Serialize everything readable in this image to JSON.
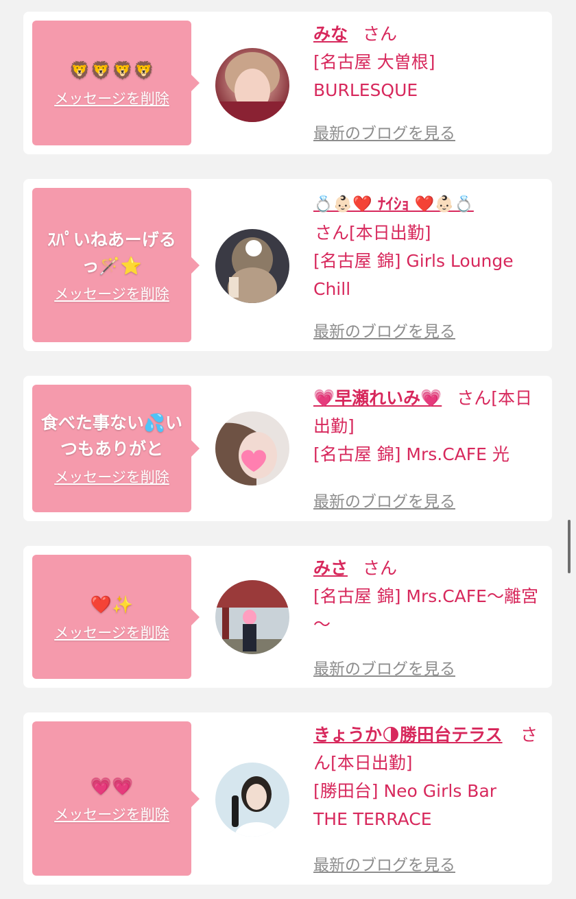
{
  "common": {
    "delete_label": "メッセージを削除",
    "blog_label": "最新のブログを見る"
  },
  "messages": [
    {
      "text": "🦁🦁🦁🦁",
      "name": "みな",
      "suffix": "さん",
      "shop": "[名古屋 大曽根] BURLESQUE"
    },
    {
      "text": "ｽﾊﾟいねあーげるっ🪄⭐️",
      "name": "💍👶🏻❤️ ﾅｲｼｮ ❤️👶🏻💍",
      "suffix": "さん[本日出勤]",
      "shop": "[名古屋 錦] Girls Lounge Chill"
    },
    {
      "text": "食べた事ない💦いつもありがと",
      "name": "💗早瀬れいみ💗",
      "suffix": "さん[本日出勤]",
      "shop": "[名古屋 錦] Mrs.CAFE 光"
    },
    {
      "text": "❤️✨",
      "name": "みさ",
      "suffix": "さん",
      "shop": "[名古屋 錦] Mrs.CAFE～離宮～"
    },
    {
      "text": "💗💗",
      "name": "きょうか🌗勝田台テラス",
      "suffix": "さん[本日出勤]",
      "shop": "[勝田台] Neo Girls Bar THE TERRACE"
    }
  ],
  "colors": {
    "accent": "#d7285c",
    "bubble": "#f59aac",
    "link_gray": "#8d8d8d",
    "background": "#f2f2f2"
  }
}
